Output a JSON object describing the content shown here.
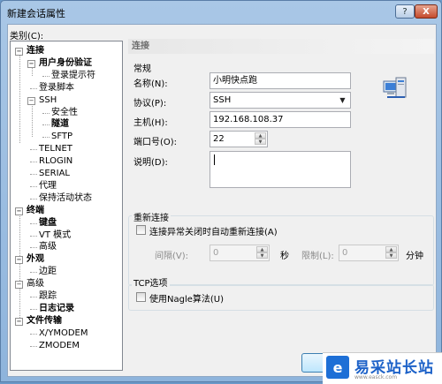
{
  "window": {
    "title": "新建会话属性",
    "help_glyph": "?",
    "close_glyph": "X"
  },
  "category_label": "类别(C):",
  "tree": [
    {
      "label": "连接",
      "bold": true,
      "selected": true
    },
    {
      "label": "用户身份验证",
      "bold": true
    },
    {
      "label": "登录提示符",
      "bold": false
    },
    {
      "label": "登录脚本",
      "bold": false
    },
    {
      "label": "SSH",
      "bold": false
    },
    {
      "label": "安全性",
      "bold": false
    },
    {
      "label": "隧道",
      "bold": true
    },
    {
      "label": "SFTP",
      "bold": false
    },
    {
      "label": "TELNET",
      "bold": false
    },
    {
      "label": "RLOGIN",
      "bold": false
    },
    {
      "label": "SERIAL",
      "bold": false
    },
    {
      "label": "代理",
      "bold": false
    },
    {
      "label": "保持活动状态",
      "bold": false
    },
    {
      "label": "终端",
      "bold": true
    },
    {
      "label": "键盘",
      "bold": true
    },
    {
      "label": "VT 模式",
      "bold": false
    },
    {
      "label": "高级",
      "bold": false
    },
    {
      "label": "外观",
      "bold": true
    },
    {
      "label": "边距",
      "bold": false
    },
    {
      "label": "高级",
      "bold": false
    },
    {
      "label": "跟踪",
      "bold": false
    },
    {
      "label": "日志记录",
      "bold": true
    },
    {
      "label": "文件传输",
      "bold": true
    },
    {
      "label": "X/YMODEM",
      "bold": false
    },
    {
      "label": "ZMODEM",
      "bold": false
    }
  ],
  "panel": {
    "header": "连接",
    "general": {
      "title": "常规",
      "name_label": "名称(N):",
      "name_value": "小明快点跑",
      "protocol_label": "协议(P):",
      "protocol_value": "SSH",
      "host_label": "主机(H):",
      "host_value": "192.168.108.37",
      "port_label": "端口号(O):",
      "port_value": "22",
      "desc_label": "说明(D):",
      "desc_value": ""
    },
    "reconnect": {
      "title": "重新连接",
      "checkbox_label": "连接异常关闭时自动重新连接(A)",
      "interval_label": "间隔(V):",
      "interval_value": "0",
      "interval_unit": "秒",
      "limit_label": "限制(L):",
      "limit_value": "0",
      "limit_unit": "分钟"
    },
    "tcp": {
      "title": "TCP选项",
      "nagle_label": "使用Nagle算法(U)"
    }
  },
  "watermark": {
    "text": "易采站长站",
    "url": "www.easck.com"
  }
}
